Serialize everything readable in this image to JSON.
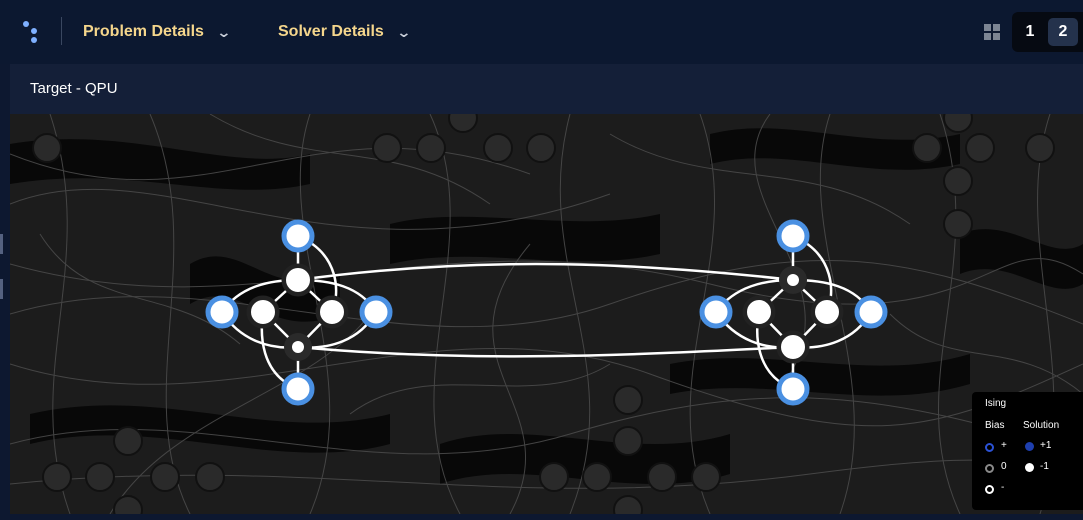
{
  "header": {
    "menus": [
      {
        "label": "Problem Details"
      },
      {
        "label": "Solver Details"
      }
    ],
    "pages": [
      "1",
      "2"
    ],
    "active_page": "2"
  },
  "panel": {
    "title": "Target - QPU"
  },
  "legend": {
    "title": "Ising",
    "bias_header": "Bias",
    "solution_header": "Solution",
    "bias_items": [
      "+",
      "0",
      "-"
    ],
    "solution_items": [
      "+1",
      "-1"
    ]
  },
  "colors": {
    "accent_blue": "#4a90e2",
    "solution_plus": "#1e3fae",
    "menu_text": "#f5d68c",
    "background": "#0d1830"
  }
}
